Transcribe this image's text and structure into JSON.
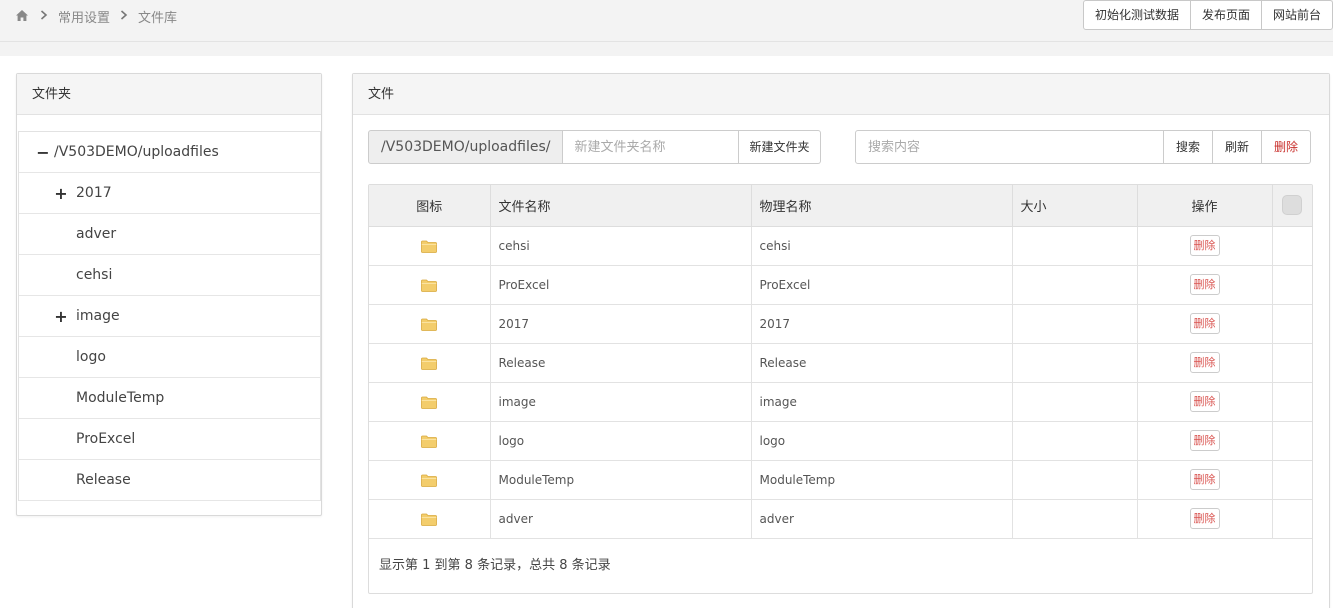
{
  "breadcrumb": {
    "items": [
      "常用设置",
      "文件库"
    ]
  },
  "top_actions": [
    "初始化测试数据",
    "发布页面",
    "网站前台"
  ],
  "left_panel": {
    "title": "文件夹",
    "tree": [
      {
        "label": "/V503DEMO/uploadfiles",
        "toggle": "−",
        "level": 0
      },
      {
        "label": "2017",
        "toggle": "+",
        "level": 1
      },
      {
        "label": "adver",
        "toggle": "",
        "level": 1
      },
      {
        "label": "cehsi",
        "toggle": "",
        "level": 1
      },
      {
        "label": "image",
        "toggle": "+",
        "level": 1
      },
      {
        "label": "logo",
        "toggle": "",
        "level": 1
      },
      {
        "label": "ModuleTemp",
        "toggle": "",
        "level": 1
      },
      {
        "label": "ProExcel",
        "toggle": "",
        "level": 1
      },
      {
        "label": "Release",
        "toggle": "",
        "level": 1
      }
    ]
  },
  "right_panel": {
    "title": "文件",
    "path": "/V503DEMO/uploadfiles/",
    "new_folder_placeholder": "新建文件夹名称",
    "new_folder_button": "新建文件夹",
    "search_placeholder": "搜索内容",
    "search_button": "搜索",
    "refresh_button": "刷新",
    "delete_button": "删除"
  },
  "table": {
    "headers": [
      "图标",
      "文件名称",
      "物理名称",
      "大小",
      "操作"
    ],
    "delete_label": "删除",
    "rows": [
      {
        "name": "cehsi",
        "physical": "cehsi",
        "size": ""
      },
      {
        "name": "ProExcel",
        "physical": "ProExcel",
        "size": ""
      },
      {
        "name": "2017",
        "physical": "2017",
        "size": ""
      },
      {
        "name": "Release",
        "physical": "Release",
        "size": ""
      },
      {
        "name": "image",
        "physical": "image",
        "size": ""
      },
      {
        "name": "logo",
        "physical": "logo",
        "size": ""
      },
      {
        "name": "ModuleTemp",
        "physical": "ModuleTemp",
        "size": ""
      },
      {
        "name": "adver",
        "physical": "adver",
        "size": ""
      }
    ],
    "footer": "显示第 1 到第 8 条记录，总共 8 条记录"
  },
  "colors": {
    "danger": "#d9534f",
    "folder": "#f5cf6b"
  }
}
